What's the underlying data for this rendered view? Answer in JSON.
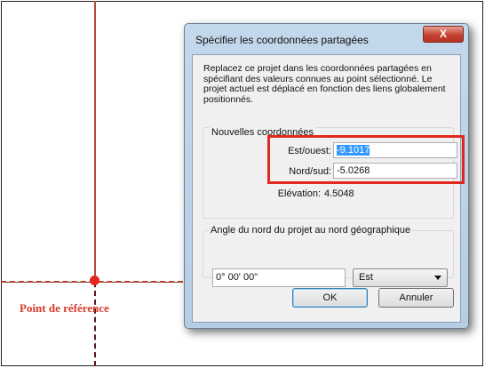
{
  "background": {
    "reference_point_label": "Point de référence",
    "reference_color": "#e0281f"
  },
  "dialog": {
    "title": "Spécifier les coordonnées partagées",
    "close_label": "X",
    "description": "Replacez ce projet dans les coordonnées partagées en spécifiant des valeurs connues au point sélectionné. Le projet actuel est déplacé en fonction des liens globalement positionnés.",
    "new_coords": {
      "legend": "Nouvelles coordonnées",
      "east_west_label": "Est/ouest:",
      "east_west_value": "-9.1017",
      "north_south_label": "Nord/sud:",
      "north_south_value": "-5.0268",
      "elevation_label": "Elévation:",
      "elevation_value": "4.5048"
    },
    "angle": {
      "legend": "Angle du nord du projet au nord géographique",
      "value": "0° 00' 00\"",
      "direction_selected": "Est"
    },
    "ok_label": "OK",
    "cancel_label": "Annuler"
  }
}
